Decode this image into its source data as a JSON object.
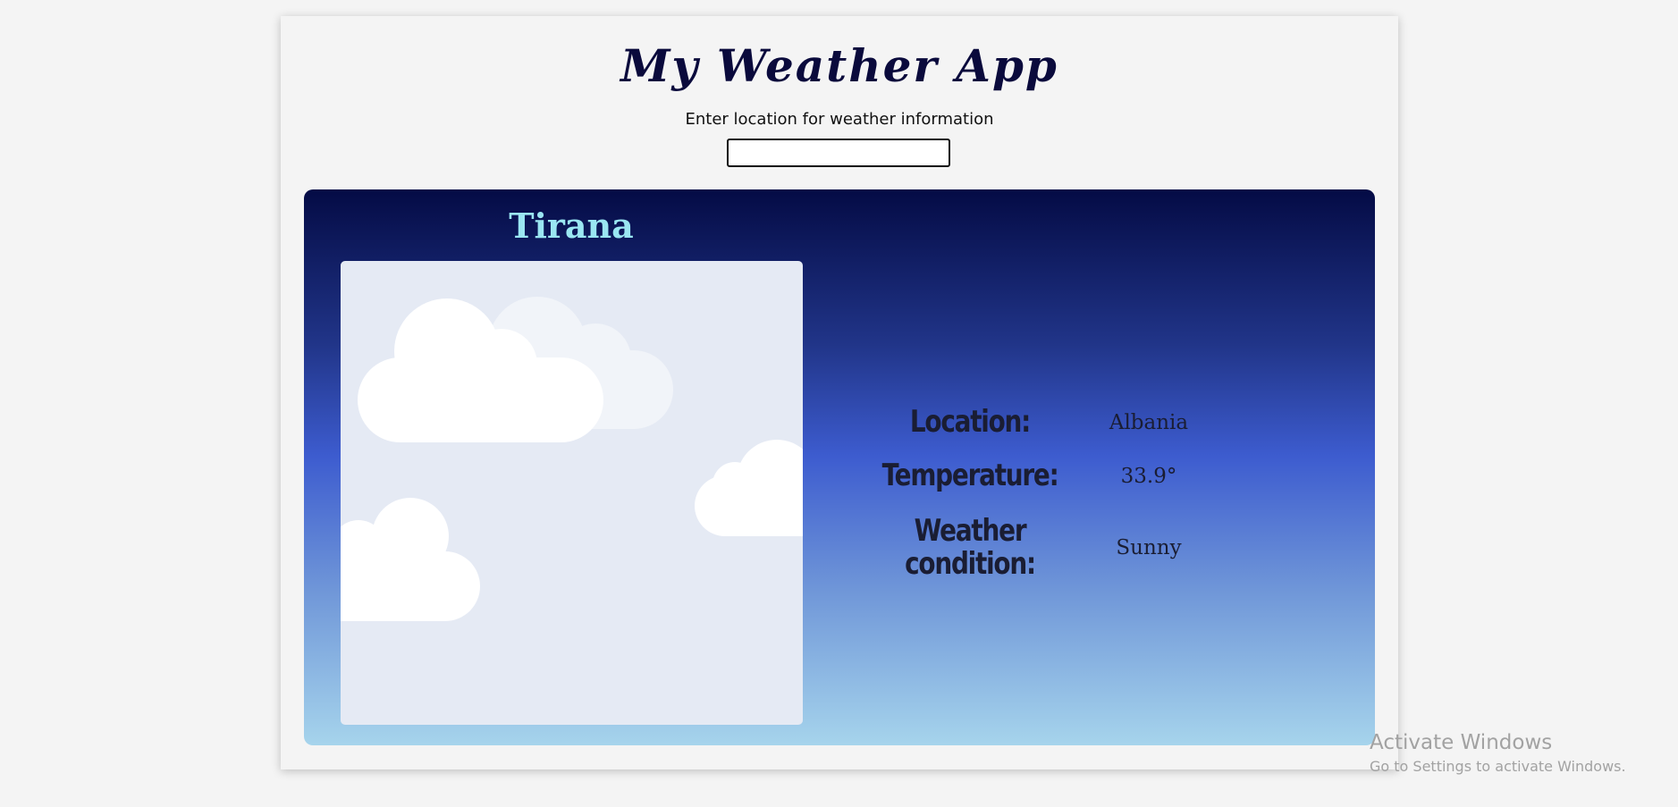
{
  "app": {
    "title": "My Weather App",
    "prompt": "Enter location for weather information"
  },
  "search": {
    "value": "",
    "placeholder": ""
  },
  "weather": {
    "city": "Tirana",
    "image_icon": "clouds-illustration",
    "rows": [
      {
        "label": "Location:",
        "value": "Albania"
      },
      {
        "label": "Temperature:",
        "value": "33.9°"
      },
      {
        "label": "Weather condition:",
        "value": "Sunny"
      }
    ]
  },
  "colors": {
    "title": "#0a0a3c",
    "city": "#9ae6f2",
    "panel_top": "#040b45",
    "panel_mid": "#3d5ccf",
    "panel_bottom": "#a6d4ec",
    "image_bg": "#e5eaf4"
  },
  "watermark": {
    "title": "Activate Windows",
    "subtitle": "Go to Settings to activate Windows."
  }
}
